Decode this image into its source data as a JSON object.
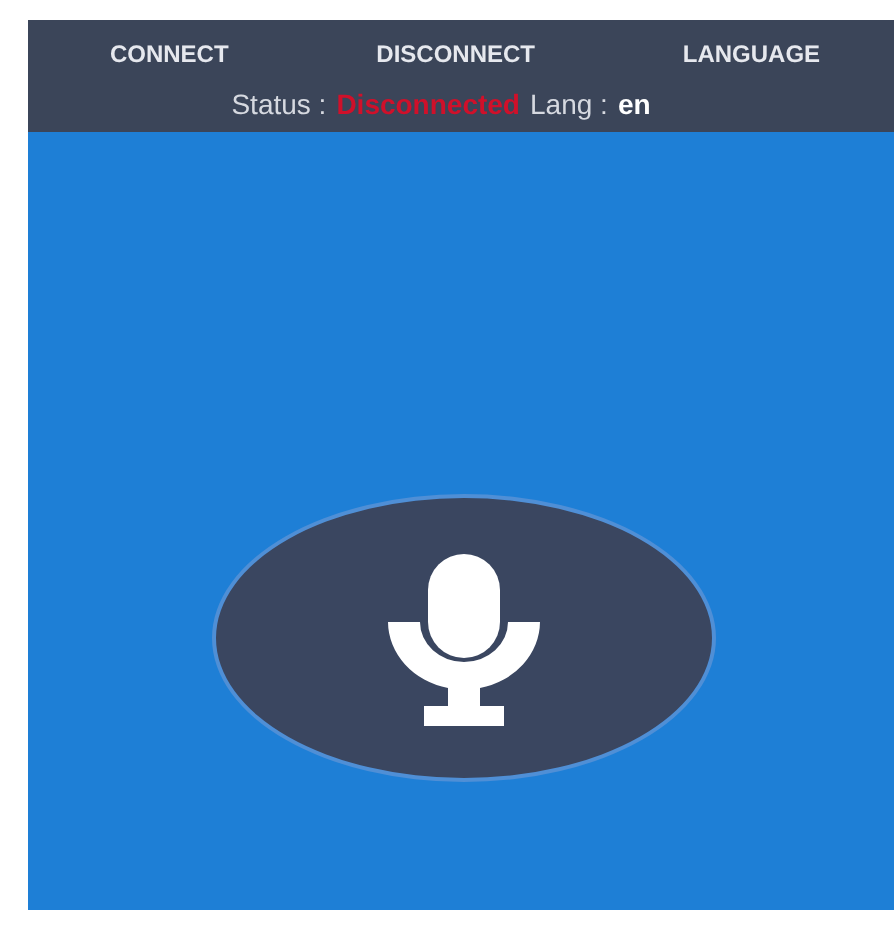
{
  "toolbar": {
    "buttons": [
      "CONNECT",
      "DISCONNECT",
      "LANGUAGE"
    ]
  },
  "status_line": {
    "status_label": "Status :",
    "status_value": "Disconnected",
    "connected": false,
    "lang_label": "Lang :",
    "lang_value": "en"
  },
  "mic_button": {
    "active": false
  }
}
